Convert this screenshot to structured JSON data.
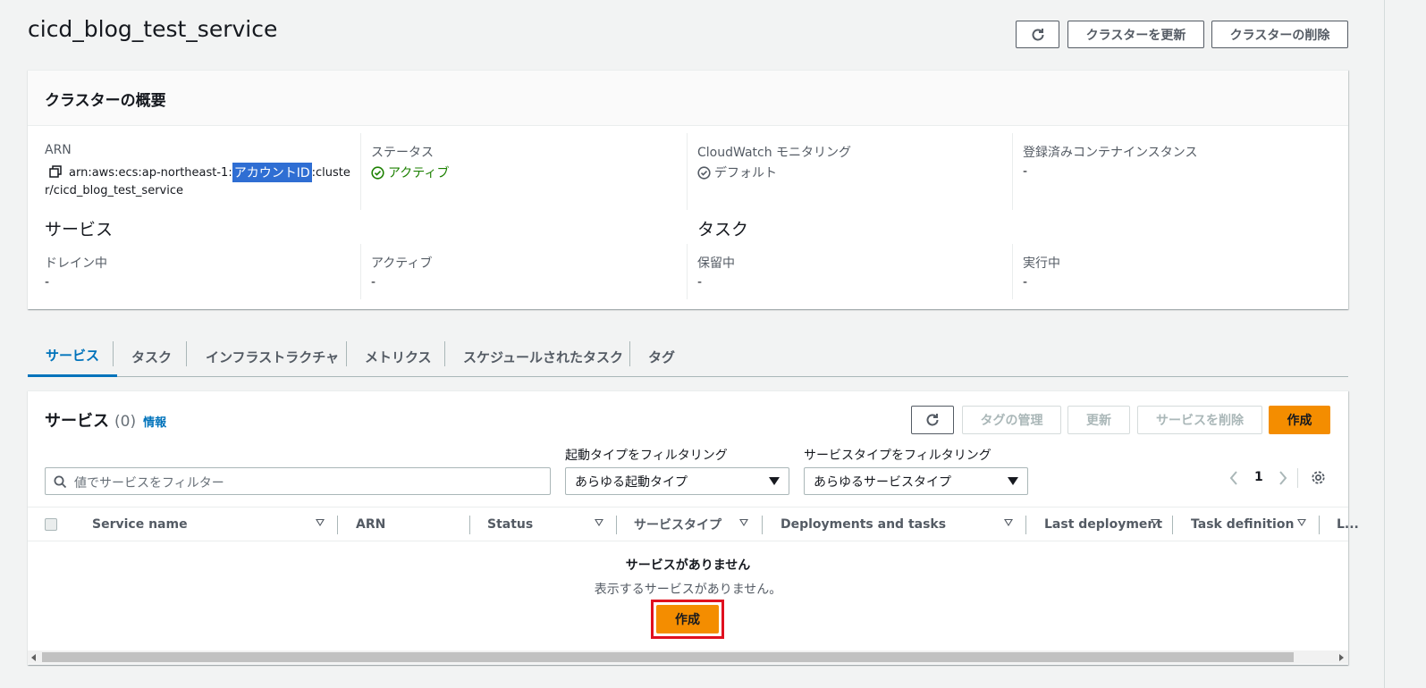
{
  "page": {
    "title": "cicd_blog_test_service"
  },
  "top_actions": {
    "update_label": "クラスターを更新",
    "delete_label": "クラスターの削除"
  },
  "overview": {
    "title": "クラスターの概要",
    "arn": {
      "label": "ARN",
      "prefix": "arn:aws:ecs:ap-northeast-1:",
      "highlight": "アカウントID",
      "suffix1": ":cluste",
      "suffix2": "r/cicd_blog_test_service"
    },
    "status": {
      "label": "ステータス",
      "value": "アクティブ"
    },
    "cloudwatch": {
      "label": "CloudWatch モニタリング",
      "value": "デフォルト"
    },
    "instances": {
      "label": "登録済みコンテナインスタンス",
      "value": "-"
    },
    "services": {
      "heading": "サービス",
      "draining_label": "ドレイン中",
      "draining_value": "-",
      "active_label": "アクティブ",
      "active_value": "-"
    },
    "tasks": {
      "heading": "タスク",
      "pending_label": "保留中",
      "pending_value": "-",
      "running_label": "実行中",
      "running_value": "-"
    }
  },
  "tabs": [
    "サービス",
    "タスク",
    "インフラストラクチャ",
    "メトリクス",
    "スケジュールされたタスク",
    "タグ"
  ],
  "services_panel": {
    "title": "サービス",
    "count": "(0)",
    "info": "情報",
    "buttons": {
      "manage_tags": "タグの管理",
      "update": "更新",
      "delete": "サービスを削除",
      "create": "作成"
    },
    "search_placeholder": "値でサービスをフィルター",
    "launch_filter": {
      "label": "起動タイプをフィルタリング",
      "value": "あらゆる起動タイプ"
    },
    "service_type_filter": {
      "label": "サービスタイプをフィルタリング",
      "value": "あらゆるサービスタイプ"
    },
    "pagination": {
      "page": "1"
    },
    "columns": [
      "Service name",
      "ARN",
      "Status",
      "サービスタイプ",
      "Deployments and tasks",
      "Last deployment",
      "Task definition",
      "L..."
    ],
    "empty": {
      "title": "サービスがありません",
      "message": "表示するサービスがありません。",
      "create": "作成"
    }
  },
  "colors": {
    "accent": "#0073bb",
    "primary": "#ec7211",
    "success": "#1d8102",
    "highlight": "#2f6ed3",
    "callout": "#e0101f"
  }
}
